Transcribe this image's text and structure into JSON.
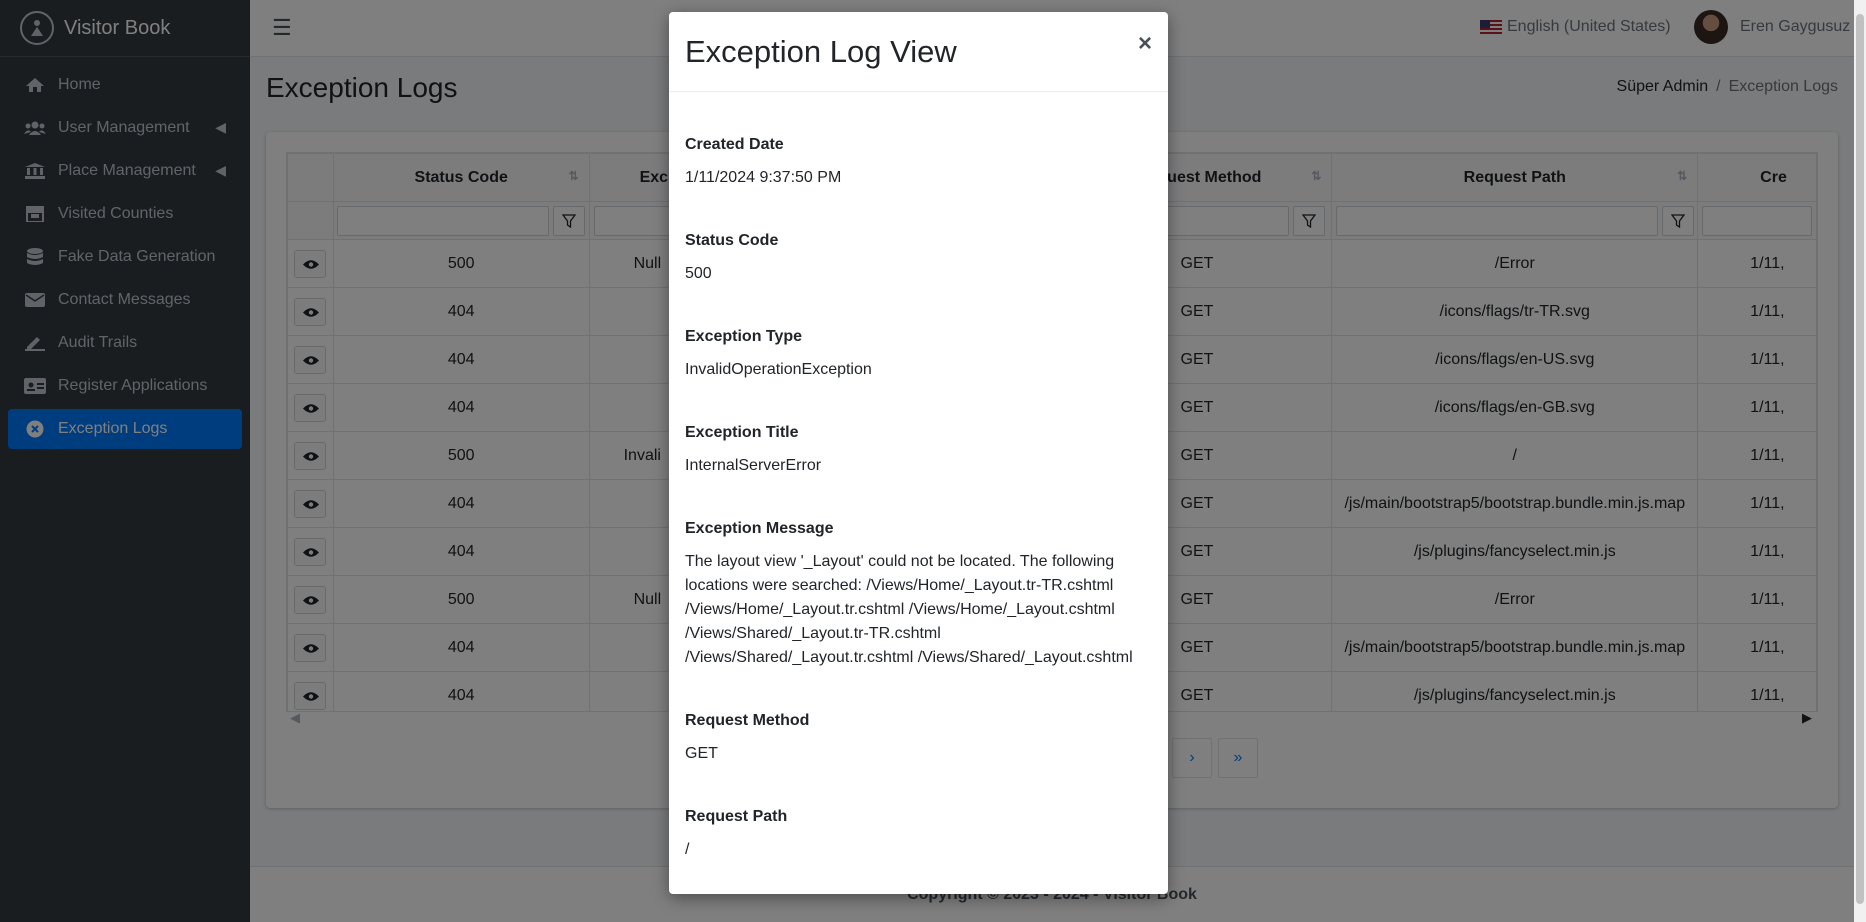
{
  "brand": {
    "name": "Visitor Book"
  },
  "sidebar": {
    "items": [
      {
        "label": "Home",
        "icon": "home-icon"
      },
      {
        "label": "User Management",
        "icon": "users-icon"
      },
      {
        "label": "Place Management",
        "icon": "bank-icon"
      },
      {
        "label": "Visited Counties",
        "icon": "store-icon"
      },
      {
        "label": "Fake Data Generation",
        "icon": "database-icon"
      },
      {
        "label": "Contact Messages",
        "icon": "envelope-icon"
      },
      {
        "label": "Audit Trails",
        "icon": "signature-icon"
      },
      {
        "label": "Register Applications",
        "icon": "id-card-icon"
      },
      {
        "label": "Exception Logs",
        "icon": "x-circle-icon"
      }
    ]
  },
  "topnav": {
    "language": "English (United States)",
    "user_name": "Eren Gaygusuz"
  },
  "header": {
    "title": "Exception Logs",
    "breadcrumb": {
      "parent": "Süper Admin",
      "current": "Exception Logs"
    }
  },
  "table": {
    "columns": [
      "Status Code",
      "Exc",
      "equest Method",
      "Request Path",
      "Cre"
    ],
    "rows": [
      {
        "status": "500",
        "exc": "Null",
        "method": "GET",
        "path": "/Error",
        "created": "1/11,"
      },
      {
        "status": "404",
        "exc": "",
        "method": "GET",
        "path": "/icons/flags/tr-TR.svg",
        "created": "1/11,"
      },
      {
        "status": "404",
        "exc": "",
        "method": "GET",
        "path": "/icons/flags/en-US.svg",
        "created": "1/11,"
      },
      {
        "status": "404",
        "exc": "",
        "method": "GET",
        "path": "/icons/flags/en-GB.svg",
        "created": "1/11,"
      },
      {
        "status": "500",
        "exc": "Invali",
        "method": "GET",
        "path": "/",
        "created": "1/11,"
      },
      {
        "status": "404",
        "exc": "",
        "method": "GET",
        "path": "/js/main/bootstrap5/bootstrap.bundle.min.js.map",
        "created": "1/11,"
      },
      {
        "status": "404",
        "exc": "",
        "method": "GET",
        "path": "/js/plugins/fancyselect.min.js",
        "created": "1/11,"
      },
      {
        "status": "500",
        "exc": "Null",
        "method": "GET",
        "path": "/Error",
        "created": "1/11,"
      },
      {
        "status": "404",
        "exc": "",
        "method": "GET",
        "path": "/js/main/bootstrap5/bootstrap.bundle.min.js.map",
        "created": "1/11,"
      },
      {
        "status": "404",
        "exc": "",
        "method": "GET",
        "path": "/js/plugins/fancyselect.min.js",
        "created": "1/11,"
      }
    ]
  },
  "pager": {
    "next": "›",
    "last": "»"
  },
  "footer": {
    "text": "Copyright © 2023 - 2024 - Visitor Book"
  },
  "modal": {
    "title": "Exception Log View",
    "close": "×",
    "fields": {
      "created_date": {
        "label": "Created Date",
        "value": "1/11/2024 9:37:50 PM"
      },
      "status_code": {
        "label": "Status Code",
        "value": "500"
      },
      "exception_type": {
        "label": "Exception Type",
        "value": "InvalidOperationException"
      },
      "exception_title": {
        "label": "Exception Title",
        "value": "InternalServerError"
      },
      "exception_message": {
        "label": "Exception Message",
        "value": "The layout view '_Layout' could not be located. The following locations were searched: /Views/Home/_Layout.tr-TR.cshtml /Views/Home/_Layout.tr.cshtml /Views/Home/_Layout.cshtml /Views/Shared/_Layout.tr-TR.cshtml /Views/Shared/_Layout.tr.cshtml /Views/Shared/_Layout.cshtml"
      },
      "request_method": {
        "label": "Request Method",
        "value": "GET"
      },
      "request_path": {
        "label": "Request Path",
        "value": "/"
      }
    }
  }
}
